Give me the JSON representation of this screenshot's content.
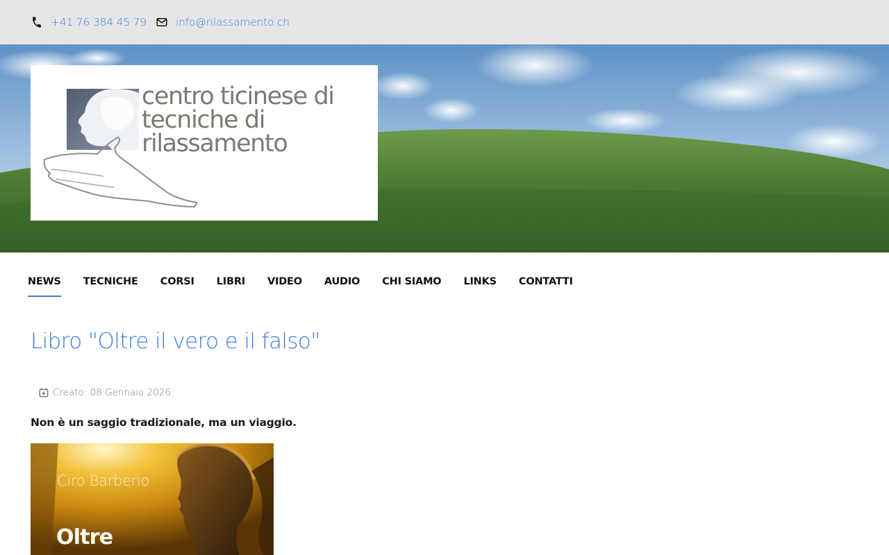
{
  "contact": {
    "phone": "+41 76 384 45 79",
    "email": "info@rilassamento.ch",
    "phone_icon": "phone-icon",
    "email_icon": "envelope-icon"
  },
  "logo": {
    "line1": "centro ticinese di",
    "line2": "tecniche di",
    "line3": "rilassamento"
  },
  "nav": {
    "items": [
      {
        "label": "NEWS",
        "active": true
      },
      {
        "label": "TECNICHE"
      },
      {
        "label": "CORSI"
      },
      {
        "label": "LIBRI"
      },
      {
        "label": "VIDEO"
      },
      {
        "label": "AUDIO"
      },
      {
        "label": "CHI SIAMO"
      },
      {
        "label": "LINKS"
      },
      {
        "label": "CONTATTI"
      }
    ]
  },
  "article": {
    "title": "Libro \"Oltre il vero e il falso\"",
    "created": "Creato: 08 Gennaio 2026",
    "calendar_icon": "calendar-plus-icon",
    "lead": "Non è un saggio tradizionale, ma un viaggio.",
    "cover": {
      "author": "Ciro Barberio",
      "title": "Oltre"
    }
  },
  "colors": {
    "accent": "#3d7de0",
    "topbar": "#e6e6e6",
    "logo_text": "#7d7970"
  }
}
